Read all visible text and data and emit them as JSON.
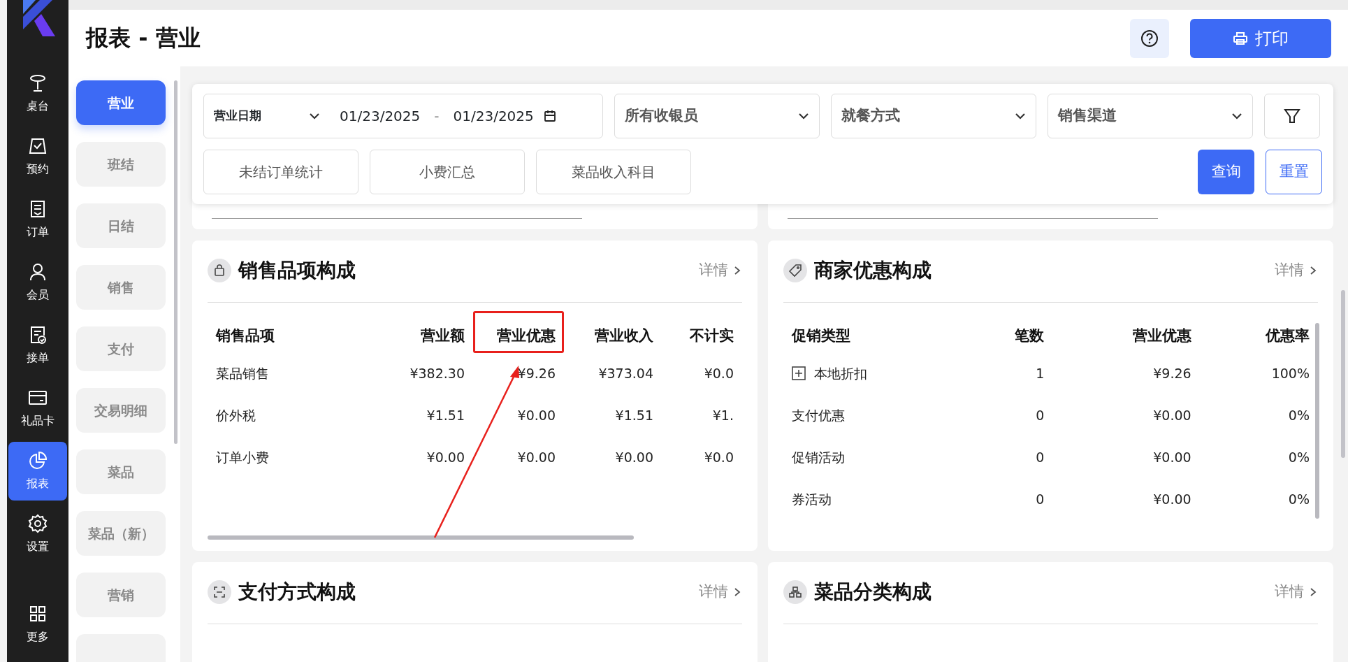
{
  "header": {
    "title": "报表 - 营业",
    "print_button": "打印"
  },
  "nav": [
    {
      "label": "桌台",
      "kind": "table",
      "selected": false
    },
    {
      "label": "预约",
      "kind": "reserve",
      "selected": false
    },
    {
      "label": "订单",
      "kind": "order",
      "selected": false
    },
    {
      "label": "会员",
      "kind": "member",
      "selected": false
    },
    {
      "label": "接单",
      "kind": "accept",
      "selected": false
    },
    {
      "label": "礼品卡",
      "kind": "card",
      "selected": false
    },
    {
      "label": "报表",
      "kind": "report",
      "selected": true
    },
    {
      "label": "设置",
      "kind": "settings",
      "selected": false
    }
  ],
  "nav_more": {
    "label": "更多"
  },
  "report_menu": [
    {
      "label": "营业",
      "selected": true
    },
    {
      "label": "班结",
      "selected": false
    },
    {
      "label": "日结",
      "selected": false
    },
    {
      "label": "销售",
      "selected": false
    },
    {
      "label": "支付",
      "selected": false
    },
    {
      "label": "交易明细",
      "selected": false
    },
    {
      "label": "菜品",
      "selected": false
    },
    {
      "label": "菜品（新）",
      "selected": false
    },
    {
      "label": "营销",
      "selected": false
    }
  ],
  "filters": {
    "date_type": "营业日期",
    "start_date": "01/23/2025",
    "separator": "-",
    "end_date": "01/23/2025",
    "selects": [
      "所有收银员",
      "就餐方式",
      "销售渠道"
    ],
    "toggles": [
      "未结订单统计",
      "小费汇总",
      "菜品收入科目"
    ],
    "query_button": "查询",
    "reset_button": "重置"
  },
  "cards": [
    {
      "title": "销售品项构成",
      "kind": "bag",
      "detail_link": "详情",
      "columns": [
        {
          "label": "销售品项",
          "highlighted": false
        },
        {
          "label": "营业额",
          "highlighted": false
        },
        {
          "label": "营业优惠",
          "highlighted": true
        },
        {
          "label": "营业收入",
          "highlighted": false
        },
        {
          "label": "不计实",
          "highlighted": false
        }
      ],
      "rows": [
        {
          "expandable": false,
          "cells": [
            "菜品销售",
            "¥382.30",
            "¥9.26",
            "¥373.04",
            "¥0.0"
          ]
        },
        {
          "expandable": false,
          "cells": [
            "价外税",
            "¥1.51",
            "¥0.00",
            "¥1.51",
            "¥1."
          ]
        },
        {
          "expandable": false,
          "cells": [
            "订单小费",
            "¥0.00",
            "¥0.00",
            "¥0.00",
            "¥0.0"
          ]
        }
      ]
    },
    {
      "title": "商家优惠构成",
      "kind": "tag",
      "detail_link": "详情",
      "columns": [
        {
          "label": "促销类型",
          "highlighted": false
        },
        {
          "label": "笔数",
          "highlighted": false
        },
        {
          "label": "营业优惠",
          "highlighted": false
        },
        {
          "label": "优惠率",
          "highlighted": false
        }
      ],
      "rows": [
        {
          "expandable": true,
          "cells": [
            "本地折扣",
            "1",
            "¥9.26",
            "100%"
          ]
        },
        {
          "expandable": false,
          "cells": [
            "支付优惠",
            "0",
            "¥0.00",
            "0%"
          ]
        },
        {
          "expandable": false,
          "cells": [
            "促销活动",
            "0",
            "¥0.00",
            "0%"
          ]
        },
        {
          "expandable": false,
          "cells": [
            "券活动",
            "0",
            "¥0.00",
            "0%"
          ]
        }
      ]
    },
    {
      "title": "支付方式构成",
      "kind": "scan",
      "detail_link": "详情"
    },
    {
      "title": "菜品分类构成",
      "kind": "tree",
      "detail_link": "详情"
    }
  ]
}
